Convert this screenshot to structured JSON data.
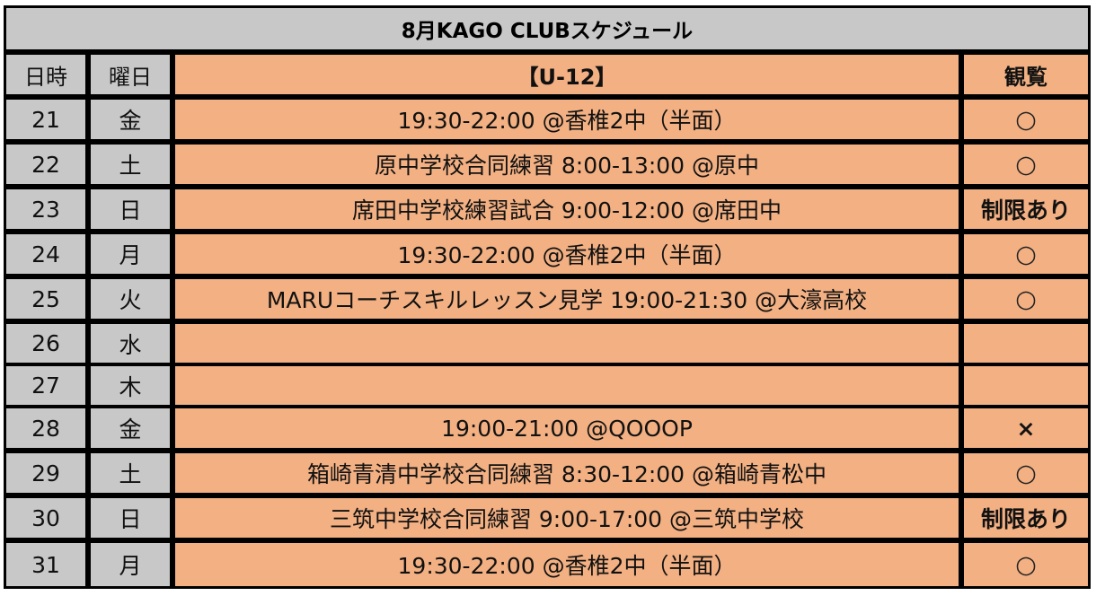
{
  "title": "8月KAGO CLUBスケジュール",
  "header": {
    "day": "日時",
    "weekday": "曜日",
    "activity": "【U-12】",
    "viewing": "観覧"
  },
  "rows": [
    {
      "day": "21",
      "weekday": "金",
      "activity": "19:30-22:00 @香椎2中（半面）",
      "viewing": "○"
    },
    {
      "day": "22",
      "weekday": "土",
      "activity": "原中学校合同練習 8:00-13:00 @原中",
      "viewing": "○"
    },
    {
      "day": "23",
      "weekday": "日",
      "activity": "席田中学校練習試合 9:00-12:00 @席田中",
      "viewing": "制限あり"
    },
    {
      "day": "24",
      "weekday": "月",
      "activity": "19:30-22:00 @香椎2中（半面）",
      "viewing": "○"
    },
    {
      "day": "25",
      "weekday": "火",
      "activity": "MARUコーチスキルレッスン見学 19:00-21:30 @大濠高校",
      "viewing": "○"
    },
    {
      "day": "26",
      "weekday": "水",
      "activity": "",
      "viewing": ""
    },
    {
      "day": "27",
      "weekday": "木",
      "activity": "",
      "viewing": ""
    },
    {
      "day": "28",
      "weekday": "金",
      "activity": "19:00-21:00 @QOOOP",
      "viewing": "×"
    },
    {
      "day": "29",
      "weekday": "土",
      "activity": "箱崎青清中学校合同練習 8:30-12:00 @箱崎青松中",
      "viewing": "○"
    },
    {
      "day": "30",
      "weekday": "日",
      "activity": "三筑中学校合同練習 9:00-17:00 @三筑中学校",
      "viewing": "制限あり"
    },
    {
      "day": "31",
      "weekday": "月",
      "activity": "19:30-22:00 @香椎2中（半面）",
      "viewing": "○"
    }
  ],
  "colors": {
    "grey_cell": "#c8c8c8",
    "salmon_cell": "#f2b083",
    "grid": "#000000"
  }
}
